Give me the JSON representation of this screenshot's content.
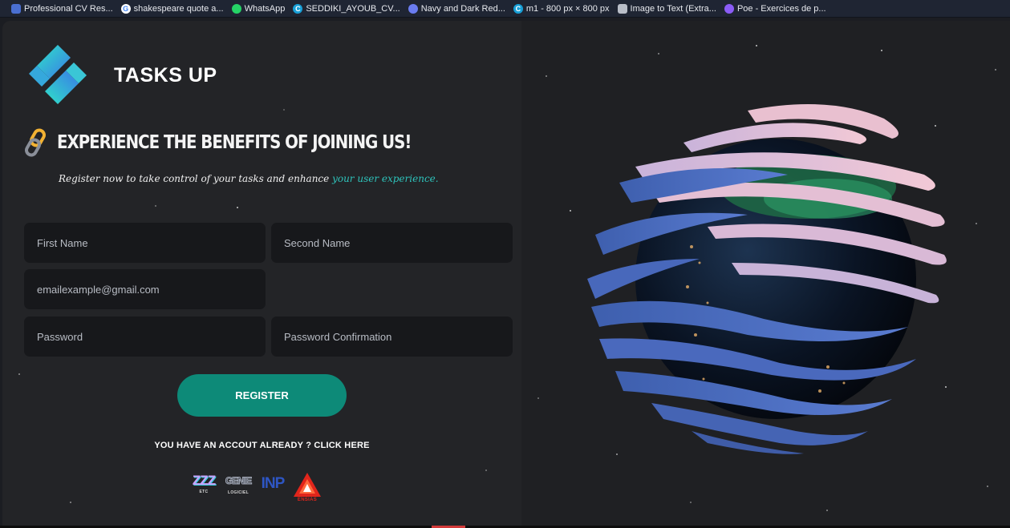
{
  "bookmarks": [
    {
      "label": "Professional CV Res...",
      "icon": "document-icon",
      "color": "#4a6fd1"
    },
    {
      "label": "shakespeare quote a...",
      "icon": "google-icon",
      "color": "#ffffff"
    },
    {
      "label": "WhatsApp",
      "icon": "whatsapp-icon",
      "color": "#25d366"
    },
    {
      "label": "SEDDIKI_AYOUB_CV...",
      "icon": "canva-icon",
      "color": "#18a0d8"
    },
    {
      "label": "Navy and Dark Red...",
      "icon": "chat-bubble-icon",
      "color": "#6a7cf0"
    },
    {
      "label": "m1 - 800 px × 800 px",
      "icon": "canva-icon",
      "color": "#18a0d8"
    },
    {
      "label": "Image to Text (Extra...",
      "icon": "image-text-icon",
      "color": "#b9bec8"
    },
    {
      "label": "Poe - Exercices de p...",
      "icon": "poe-icon",
      "color": "#8b5cf6"
    }
  ],
  "brand": {
    "name": "TASKS UP"
  },
  "hero": {
    "headline": "EXPERIENCE THE BENEFITS OF JOINING US!",
    "subtitle_main": "Register now to take control of your tasks and enhance ",
    "subtitle_highlight": "your user experience."
  },
  "form": {
    "first_name_placeholder": "First Name",
    "second_name_placeholder": "Second Name",
    "email_placeholder": "emailexample@gmail.com",
    "password_placeholder": "Password",
    "password_confirm_placeholder": "Password Confirmation",
    "submit_label": "REGISTER"
  },
  "login_prompt": "YOU HAVE AN ACCOUT ALREADY ? CLICK HERE",
  "partners": [
    {
      "text": "ZZZ",
      "sub": "ETC",
      "icon": "zzz-logo-icon"
    },
    {
      "text": "GENIE",
      "sub": "LOGICIEL",
      "icon": "genie-logo-icon"
    },
    {
      "text": "INP",
      "sub": "",
      "icon": "inp-logo-icon"
    },
    {
      "text": "",
      "sub": "ENSIAS",
      "icon": "ensias-logo-icon"
    }
  ],
  "colors": {
    "accent": "#0d8a78",
    "highlight": "#2ec3bb",
    "field_bg": "#17181b",
    "panel_bg": "#232427"
  }
}
